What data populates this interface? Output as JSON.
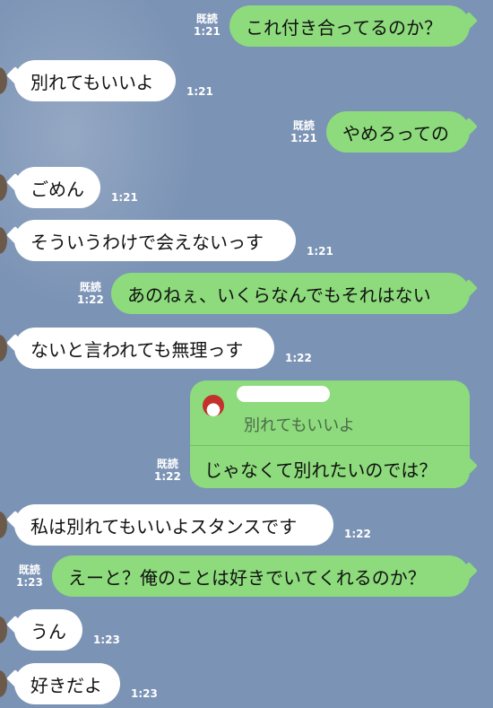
{
  "read_label": "既読",
  "messages": [
    {
      "text": "これ付き合ってるのか？",
      "time": "1:21"
    },
    {
      "text": "別れてもいいよ",
      "time": "1:21"
    },
    {
      "text": "やめろっての",
      "time": "1:21"
    },
    {
      "text": "ごめん",
      "time": "1:21"
    },
    {
      "text": "そういうわけで会えないっす",
      "time": "1:21"
    },
    {
      "text": "あのねぇ、いくらなんでもそれはない",
      "time": "1:22"
    },
    {
      "text": "ないと言われても無理っす",
      "time": "1:22"
    },
    {
      "quoted_text": "別れてもいいよ",
      "text": "じゃなくて別れたいのでは？",
      "time": "1:22"
    },
    {
      "text": "私は別れてもいいよスタンスです",
      "time": "1:22"
    },
    {
      "text": "えーと？俺のことは好きでいてくれるのか？",
      "time": "1:23"
    },
    {
      "text": "うん",
      "time": "1:23"
    },
    {
      "text": "好きだよ",
      "time": "1:23"
    }
  ],
  "colors": {
    "background": "#7b93b5",
    "incoming_bubble": "#ffffff",
    "outgoing_bubble": "#8ddb7c",
    "meta_text": "#ffffff"
  }
}
